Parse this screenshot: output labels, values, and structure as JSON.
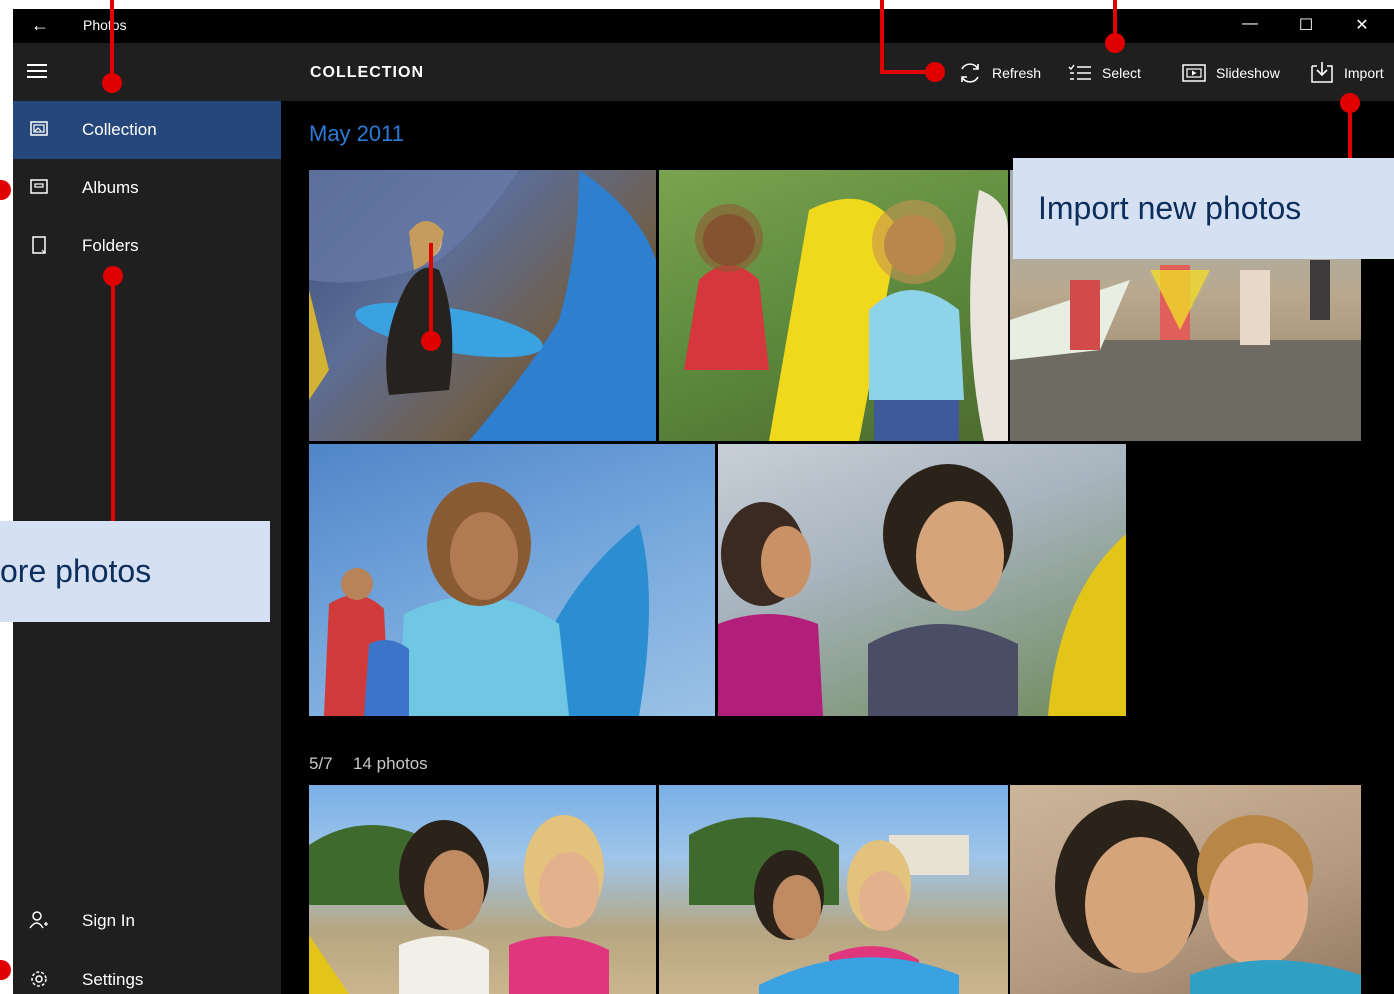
{
  "window": {
    "title": "Photos",
    "back_label": "←",
    "minimize_label": "—",
    "maximize_label": "☐",
    "close_label": "✕"
  },
  "sidebar": {
    "items": [
      {
        "label": "Collection",
        "icon": "collection-icon",
        "active": true
      },
      {
        "label": "Albums",
        "icon": "album-icon",
        "active": false
      },
      {
        "label": "Folders",
        "icon": "folder-icon",
        "active": false
      }
    ],
    "bottom_items": [
      {
        "label": "Sign In",
        "icon": "person-icon"
      },
      {
        "label": "Settings",
        "icon": "gear-icon"
      }
    ]
  },
  "toolbar": {
    "heading": "COLLECTION",
    "buttons": [
      {
        "label": "Refresh",
        "icon": "refresh-icon"
      },
      {
        "label": "Select",
        "icon": "select-icon"
      },
      {
        "label": "Slideshow",
        "icon": "slideshow-icon"
      },
      {
        "label": "Import",
        "icon": "import-icon"
      }
    ]
  },
  "content": {
    "group_title": "May 2011",
    "subgroup_date": "5/7",
    "subgroup_count": "14 photos"
  },
  "callouts": {
    "import": "Import new photos",
    "left_partial": "ore photos"
  },
  "colors": {
    "accent": "#2b7bd6",
    "active_nav": "#25477c",
    "annotation_red": "#e00000",
    "callout_bg": "#d5e1f2"
  }
}
